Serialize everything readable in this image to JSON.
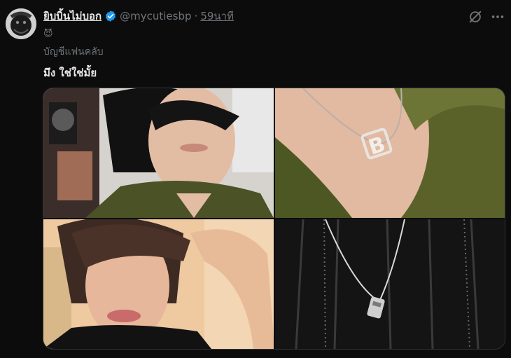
{
  "tweet": {
    "display_name": "ยิบบิ้นไม่บอก",
    "handle": "@mycutiesbp",
    "separator": "·",
    "time": "59นาที",
    "emoji": "😈",
    "fan_account_label": "บัญชีแฟนคลับ",
    "text": "มึง ใช่ใช่มั้ย"
  },
  "colors": {
    "verified": "#1d9bf0",
    "muted": "#71767b",
    "text": "#e7e9ea",
    "background": "#0c0c0c"
  },
  "media": [
    {
      "name": "photo-top-left"
    },
    {
      "name": "photo-top-right"
    },
    {
      "name": "photo-bottom-left"
    },
    {
      "name": "photo-bottom-right"
    }
  ],
  "icons": [
    "verified-icon",
    "grok-icon",
    "more-icon"
  ]
}
